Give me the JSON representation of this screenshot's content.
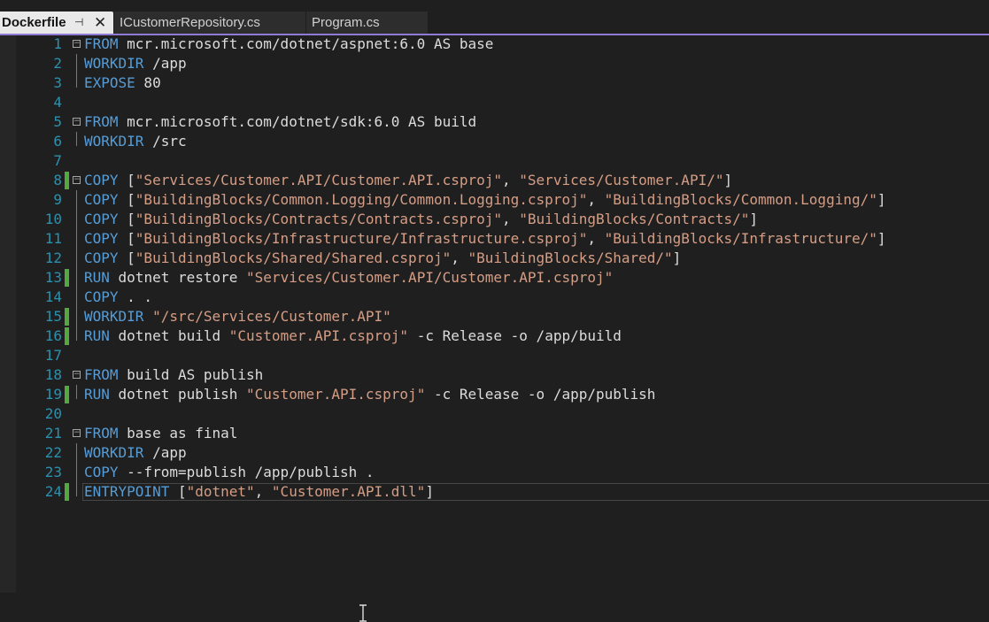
{
  "tabs": [
    {
      "label": "Dockerfile",
      "active": true,
      "pinned_icon": "pin-icon"
    },
    {
      "label": "ICustomerRepository.cs",
      "active": false
    },
    {
      "label": "Program.cs",
      "active": false
    }
  ],
  "lines": [
    {
      "n": "1",
      "fold": true,
      "changed": false,
      "tokens": [
        [
          "kw",
          "FROM"
        ],
        [
          "txt",
          " mcr.microsoft.com/dotnet/aspnet:6.0 AS base"
        ]
      ]
    },
    {
      "n": "2",
      "fold": false,
      "changed": false,
      "tokens": [
        [
          "kw",
          "WORKDIR"
        ],
        [
          "txt",
          " /app"
        ]
      ]
    },
    {
      "n": "3",
      "fold": false,
      "changed": false,
      "tokens": [
        [
          "kw",
          "EXPOSE"
        ],
        [
          "txt",
          " 80"
        ]
      ]
    },
    {
      "n": "4",
      "fold": false,
      "changed": false,
      "tokens": []
    },
    {
      "n": "5",
      "fold": true,
      "changed": false,
      "tokens": [
        [
          "kw",
          "FROM"
        ],
        [
          "txt",
          " mcr.microsoft.com/dotnet/sdk:6.0 AS build"
        ]
      ]
    },
    {
      "n": "6",
      "fold": false,
      "changed": false,
      "tokens": [
        [
          "kw",
          "WORKDIR"
        ],
        [
          "txt",
          " /src"
        ]
      ]
    },
    {
      "n": "7",
      "fold": false,
      "changed": false,
      "tokens": []
    },
    {
      "n": "8",
      "fold": true,
      "changed": true,
      "tokens": [
        [
          "kw",
          "COPY"
        ],
        [
          "txt",
          " ["
        ],
        [
          "str",
          "\"Services/Customer.API/Customer.API.csproj\""
        ],
        [
          "txt",
          ", "
        ],
        [
          "str",
          "\"Services/Customer.API/\""
        ],
        [
          "txt",
          "]"
        ]
      ]
    },
    {
      "n": "9",
      "fold": false,
      "changed": false,
      "tokens": [
        [
          "kw",
          "COPY"
        ],
        [
          "txt",
          " ["
        ],
        [
          "str",
          "\"BuildingBlocks/Common.Logging/Common.Logging.csproj\""
        ],
        [
          "txt",
          ", "
        ],
        [
          "str",
          "\"BuildingBlocks/Common.Logging/\""
        ],
        [
          "txt",
          "]"
        ]
      ]
    },
    {
      "n": "10",
      "fold": false,
      "changed": false,
      "tokens": [
        [
          "kw",
          "COPY"
        ],
        [
          "txt",
          " ["
        ],
        [
          "str",
          "\"BuildingBlocks/Contracts/Contracts.csproj\""
        ],
        [
          "txt",
          ", "
        ],
        [
          "str",
          "\"BuildingBlocks/Contracts/\""
        ],
        [
          "txt",
          "]"
        ]
      ]
    },
    {
      "n": "11",
      "fold": false,
      "changed": false,
      "tokens": [
        [
          "kw",
          "COPY"
        ],
        [
          "txt",
          " ["
        ],
        [
          "str",
          "\"BuildingBlocks/Infrastructure/Infrastructure.csproj\""
        ],
        [
          "txt",
          ", "
        ],
        [
          "str",
          "\"BuildingBlocks/Infrastructure/\""
        ],
        [
          "txt",
          "]"
        ]
      ]
    },
    {
      "n": "12",
      "fold": false,
      "changed": false,
      "tokens": [
        [
          "kw",
          "COPY"
        ],
        [
          "txt",
          " ["
        ],
        [
          "str",
          "\"BuildingBlocks/Shared/Shared.csproj\""
        ],
        [
          "txt",
          ", "
        ],
        [
          "str",
          "\"BuildingBlocks/Shared/\""
        ],
        [
          "txt",
          "]"
        ]
      ]
    },
    {
      "n": "13",
      "fold": false,
      "changed": true,
      "tokens": [
        [
          "kw",
          "RUN"
        ],
        [
          "txt",
          " dotnet restore "
        ],
        [
          "str",
          "\"Services/Customer.API/Customer.API.csproj\""
        ]
      ]
    },
    {
      "n": "14",
      "fold": false,
      "changed": false,
      "tokens": [
        [
          "kw",
          "COPY"
        ],
        [
          "txt",
          " . ."
        ]
      ]
    },
    {
      "n": "15",
      "fold": false,
      "changed": true,
      "tokens": [
        [
          "kw",
          "WORKDIR"
        ],
        [
          "txt",
          " "
        ],
        [
          "str",
          "\"/src/Services/Customer.API\""
        ]
      ]
    },
    {
      "n": "16",
      "fold": false,
      "changed": true,
      "tokens": [
        [
          "kw",
          "RUN"
        ],
        [
          "txt",
          " dotnet build "
        ],
        [
          "str",
          "\"Customer.API.csproj\""
        ],
        [
          "txt",
          " -c Release -o /app/build"
        ]
      ]
    },
    {
      "n": "17",
      "fold": false,
      "changed": false,
      "tokens": []
    },
    {
      "n": "18",
      "fold": true,
      "changed": false,
      "tokens": [
        [
          "kw",
          "FROM"
        ],
        [
          "txt",
          " build AS publish"
        ]
      ]
    },
    {
      "n": "19",
      "fold": false,
      "changed": true,
      "tokens": [
        [
          "kw",
          "RUN"
        ],
        [
          "txt",
          " dotnet publish "
        ],
        [
          "str",
          "\"Customer.API.csproj\""
        ],
        [
          "txt",
          " -c Release -o /app/publish"
        ]
      ]
    },
    {
      "n": "20",
      "fold": false,
      "changed": false,
      "tokens": []
    },
    {
      "n": "21",
      "fold": true,
      "changed": false,
      "tokens": [
        [
          "kw",
          "FROM"
        ],
        [
          "txt",
          " base as final"
        ]
      ]
    },
    {
      "n": "22",
      "fold": false,
      "changed": false,
      "tokens": [
        [
          "kw",
          "WORKDIR"
        ],
        [
          "txt",
          " /app"
        ]
      ]
    },
    {
      "n": "23",
      "fold": false,
      "changed": false,
      "tokens": [
        [
          "kw",
          "COPY"
        ],
        [
          "txt",
          " --from=publish /app/publish ."
        ]
      ]
    },
    {
      "n": "24",
      "fold": false,
      "changed": true,
      "current": true,
      "tokens": [
        [
          "kw",
          "ENTRYPOINT"
        ],
        [
          "txt",
          " ["
        ],
        [
          "str",
          "\"dotnet\""
        ],
        [
          "txt",
          ", "
        ],
        [
          "str",
          "\"Customer.API.dll\""
        ],
        [
          "txt",
          "]"
        ]
      ]
    }
  ],
  "colors": {
    "keyword": "#569cd6",
    "string": "#d69d85",
    "text": "#dcdcdc",
    "line_number": "#2b91af",
    "change_marker": "#53a93f",
    "accent": "#8f7ad6"
  }
}
